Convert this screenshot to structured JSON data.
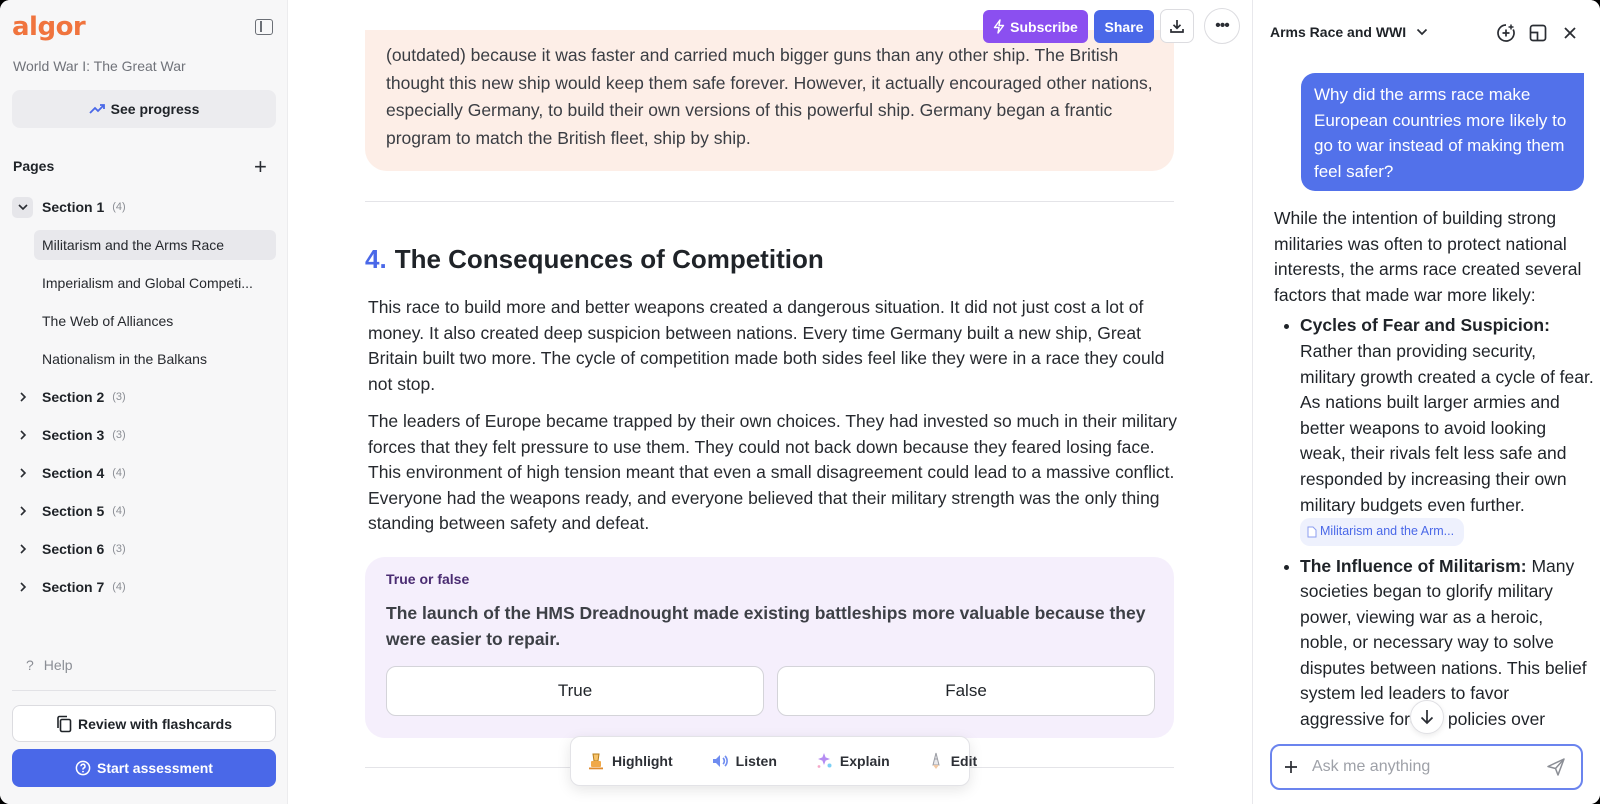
{
  "app": {
    "logo_text": "algor",
    "brand_color": "#f0743e",
    "accent_color": "#4a68e8"
  },
  "sidebar": {
    "doc_title": "World War I: The Great War",
    "see_progress_label": "See progress",
    "pages_heading": "Pages",
    "sections": [
      {
        "label": "Section 1",
        "count": "(4)",
        "expanded": true,
        "pages": [
          "Militarism and the Arms Race",
          "Imperialism and Global Competi...",
          "The Web of Alliances",
          "Nationalism in the Balkans"
        ],
        "active_page": 0
      },
      {
        "label": "Section 2",
        "count": "(3)",
        "expanded": false
      },
      {
        "label": "Section 3",
        "count": "(3)",
        "expanded": false
      },
      {
        "label": "Section 4",
        "count": "(4)",
        "expanded": false
      },
      {
        "label": "Section 5",
        "count": "(4)",
        "expanded": false
      },
      {
        "label": "Section 6",
        "count": "(3)",
        "expanded": false
      },
      {
        "label": "Section 7",
        "count": "(4)",
        "expanded": false
      }
    ],
    "help_label": "Help",
    "flashcards_label": "Review with flashcards",
    "assessment_label": "Start assessment"
  },
  "toolbar": {
    "subscribe_label": "Subscribe",
    "subscribe_color": "#8b4ff0",
    "share_label": "Share"
  },
  "main": {
    "callout_text": "(outdated) because it was faster and carried much bigger guns than any other ship. The British thought this new ship would keep them safe forever. However, it actually encouraged other nations, especially Germany, to build their own versions of this powerful ship. Germany began a frantic program to match the British fleet, ship by ship.",
    "section_number": "4.",
    "section_title": "The Consequences of Competition",
    "paragraphs": [
      "This race to build more and better weapons created a dangerous situation. It did not just cost a lot of money. It also created deep suspicion between nations. Every time Germany built a new ship, Great Britain built two more. The cycle of competition made both sides feel like they were in a race they could not stop.",
      "The leaders of Europe became trapped by their own choices. They had invested so much in their military forces that they felt pressure to use them. They could not back down because they feared losing face. This environment of high tension meant that even a small disagreement could lead to a massive conflict. Everyone had the weapons ready, and everyone believed that their military strength was the only thing standing between safety and defeat."
    ],
    "quiz": {
      "kind": "True or false",
      "question": "The launch of the HMS Dreadnought made existing battleships more valuable because they were easier to repair.",
      "options": [
        "True",
        "False"
      ]
    },
    "floating_toolbar": [
      "Highlight",
      "Listen",
      "Explain",
      "Edit"
    ]
  },
  "chat": {
    "title": "Arms Race and WWI",
    "user_message": "Why did the arms race make European countries more likely to go to war instead of making them feel safer?",
    "reply_intro": "While the intention of building strong militaries was often to protect national interests, the arms race created several factors that made war more likely:",
    "bullets": [
      {
        "title": "Cycles of Fear and Suspicion:",
        "text": "Rather than providing security, military growth created a cycle of fear. As nations built larger armies and better weapons to avoid looking weak, their rivals felt less safe and responded by increasing their own military budgets even further.",
        "citation": "Militarism and the Arm..."
      },
      {
        "title": "The Influence of Militarism:",
        "text": "Many societies began to glorify military power, viewing war as a heroic, noble, or necessary way to solve disputes between nations. This belief system led leaders to favor aggressive foreign policies over"
      }
    ],
    "input_placeholder": "Ask me anything"
  }
}
